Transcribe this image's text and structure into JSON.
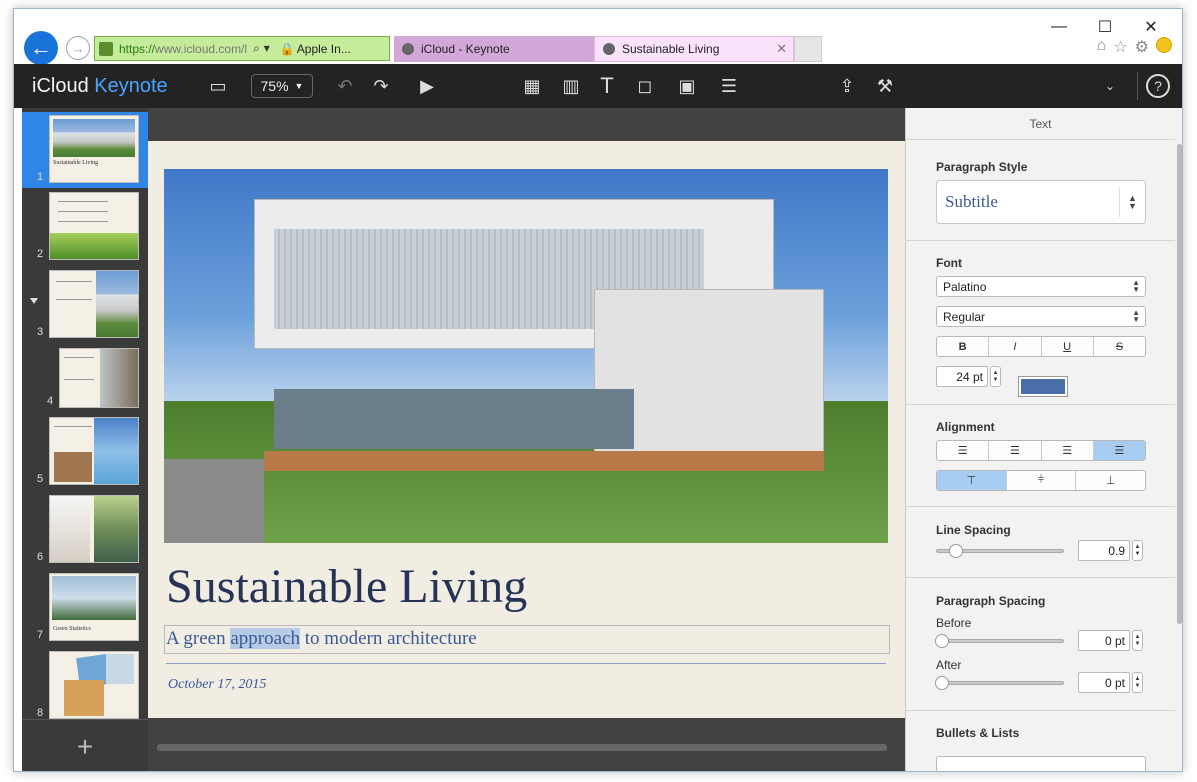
{
  "browser": {
    "url_secure": "https://",
    "url_host": "www.icloud.com/",
    "url_rest": "l",
    "cert_label": "Apple In...",
    "tabs": [
      {
        "label": "iCloud - Keynote"
      },
      {
        "label": "Sustainable Living"
      }
    ],
    "window_controls": {
      "minimize": "—",
      "maximize": "☐",
      "close": "✕"
    }
  },
  "app": {
    "brand_prefix": "iCloud",
    "brand_suffix": "Keynote",
    "zoom": "75%"
  },
  "navigator": {
    "slides": [
      {
        "num": "1",
        "title": "Sustainable Living"
      },
      {
        "num": "2",
        "title": ""
      },
      {
        "num": "3",
        "title": ""
      },
      {
        "num": "4",
        "title": ""
      },
      {
        "num": "5",
        "title": ""
      },
      {
        "num": "6",
        "title": ""
      },
      {
        "num": "7",
        "title": "Green Statistics"
      },
      {
        "num": "8",
        "title": ""
      }
    ],
    "add_label": "+"
  },
  "slide": {
    "title": "Sustainable Living",
    "subtitle_before": "A green ",
    "subtitle_highlight": "approach",
    "subtitle_after": " to modern architecture",
    "date": "October 17, 2015"
  },
  "inspector": {
    "tab": "Text",
    "paragraph_style_label": "Paragraph Style",
    "paragraph_style_value": "Subtitle",
    "font_label": "Font",
    "font_family": "Palatino",
    "font_weight": "Regular",
    "style_buttons": [
      "B",
      "I",
      "U",
      "S"
    ],
    "font_size": "24 pt",
    "text_color": "#4a6ea8",
    "alignment_label": "Alignment",
    "line_spacing_label": "Line Spacing",
    "line_spacing": "0.9",
    "paragraph_spacing_label": "Paragraph Spacing",
    "before_label": "Before",
    "before_value": "0 pt",
    "after_label": "After",
    "after_value": "0 pt",
    "bullets_label": "Bullets & Lists"
  },
  "colors": {
    "accent": "#2f86e6",
    "toolbar": "#232323",
    "keynote_blue": "#4aa3ff"
  }
}
